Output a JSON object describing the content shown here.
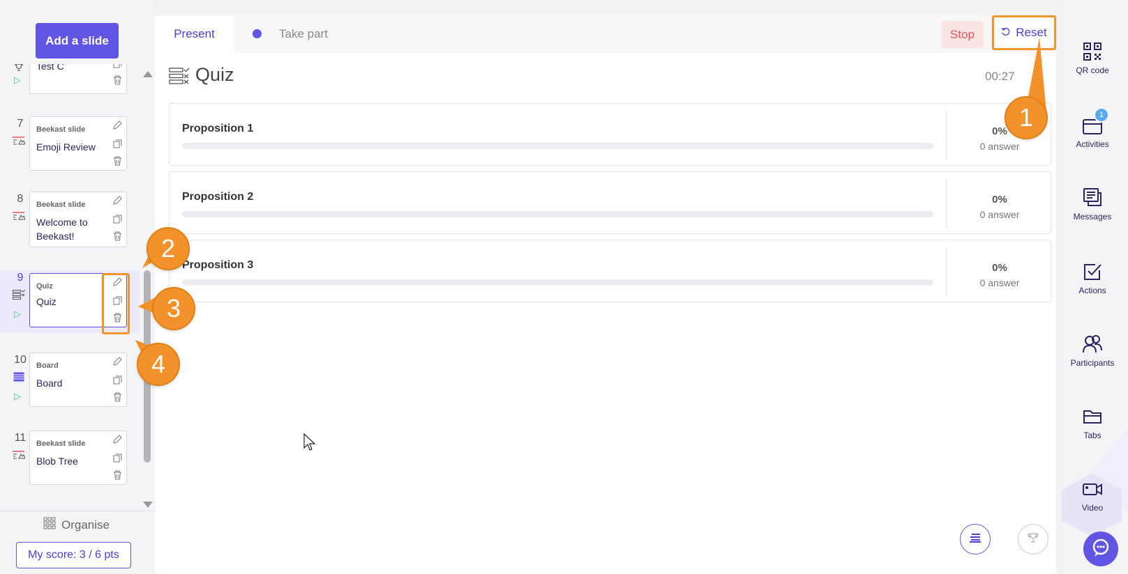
{
  "left_panel": {
    "add_slide_label": "Add a slide",
    "slides": [
      {
        "num": "",
        "type": "",
        "title": "Test C",
        "icon": "trophy-icon",
        "playable": true
      },
      {
        "num": "7",
        "type": "Beekast slide",
        "title": "Emoji Review",
        "icon": "beekast-slide-icon",
        "playable": false
      },
      {
        "num": "8",
        "type": "Beekast slide",
        "title": "Welcome to Beekast!",
        "icon": "beekast-slide-icon",
        "playable": false
      },
      {
        "num": "9",
        "type": "Quiz",
        "title": "Quiz",
        "icon": "quiz-icon",
        "playable": true,
        "active": true
      },
      {
        "num": "10",
        "type": "Board",
        "title": "Board",
        "icon": "board-icon",
        "playable": true
      },
      {
        "num": "11",
        "type": "Beekast slide",
        "title": "Blob Tree",
        "icon": "beekast-slide-icon",
        "playable": false
      }
    ],
    "organise_label": "Organise",
    "score_label": "My score: 3 / 6 pts"
  },
  "main": {
    "tabs": {
      "present": "Present",
      "take_part": "Take part"
    },
    "stop_label": "Stop",
    "reset_label": "Reset",
    "activity_title": "Quiz",
    "timer": "00:27",
    "propositions": [
      {
        "label": "Proposition 1",
        "percent": "0%",
        "answers": "0 answer",
        "fill": 0
      },
      {
        "label": "Proposition 2",
        "percent": "0%",
        "answers": "0 answer",
        "fill": 0
      },
      {
        "label": "Proposition 3",
        "percent": "0%",
        "answers": "0 answer",
        "fill": 0
      }
    ]
  },
  "right_rail": {
    "items": [
      {
        "label": "QR code",
        "icon": "qr-code-icon"
      },
      {
        "label": "Activities",
        "icon": "activities-icon",
        "badge": "1"
      },
      {
        "label": "Messages",
        "icon": "messages-icon"
      },
      {
        "label": "Actions",
        "icon": "actions-icon"
      },
      {
        "label": "Participants",
        "icon": "participants-icon"
      },
      {
        "label": "Tabs",
        "icon": "tabs-icon"
      },
      {
        "label": "Video",
        "icon": "video-icon"
      }
    ]
  },
  "annotations": {
    "c1": "1",
    "c2": "2",
    "c3": "3",
    "c4": "4"
  },
  "colors": {
    "accent": "#6155e4",
    "callout": "#f3922b",
    "stop": "#e55454",
    "play": "#3cc480"
  }
}
